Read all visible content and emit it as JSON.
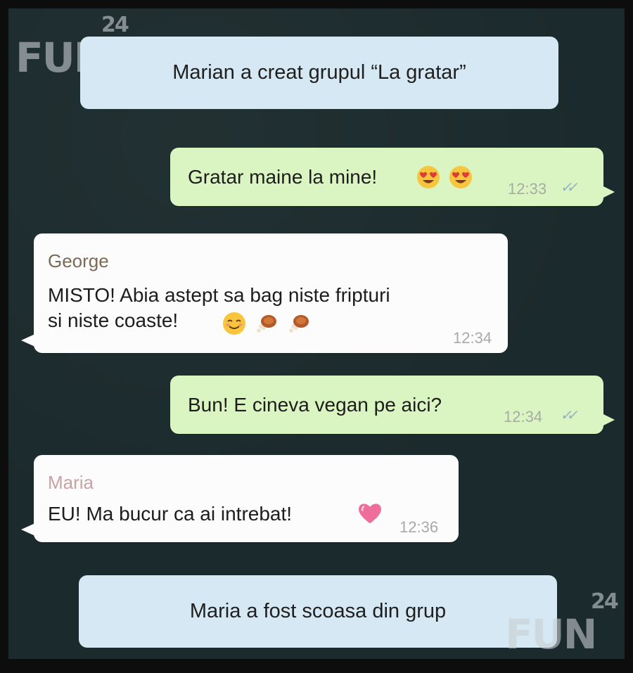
{
  "watermark": {
    "text": "FUN",
    "number": "24"
  },
  "messages": {
    "group_created": "Marian a creat grupul “La gratar”",
    "m1": {
      "text": "Gratar maine la mine!",
      "time": "12:33",
      "emoji": "heart-eyes-emoji"
    },
    "m2": {
      "sender": "George",
      "text": "MISTO! Abia astept sa bag niste fripturi\nsi niste coaste!",
      "time": "12:34",
      "emoji": "smile-blush-emoji, meat-emoji, meat-emoji"
    },
    "m3": {
      "text": "Bun! E cineva vegan pe aici?",
      "time": "12:34"
    },
    "m4": {
      "sender": "Maria",
      "text": "EU! Ma bucur ca ai intrebat!",
      "time": "12:36",
      "emoji": "heart-emoji"
    },
    "removed": "Maria a fost scoasa din grup"
  },
  "colors": {
    "background": "#1b2a2c",
    "outgoing": "#dbf5c2",
    "incoming": "#fcfcfc",
    "system": "#d5e8f3",
    "george": "#7d6a55",
    "maria": "#c7a2a8",
    "ticks": "#8fb0c3"
  }
}
